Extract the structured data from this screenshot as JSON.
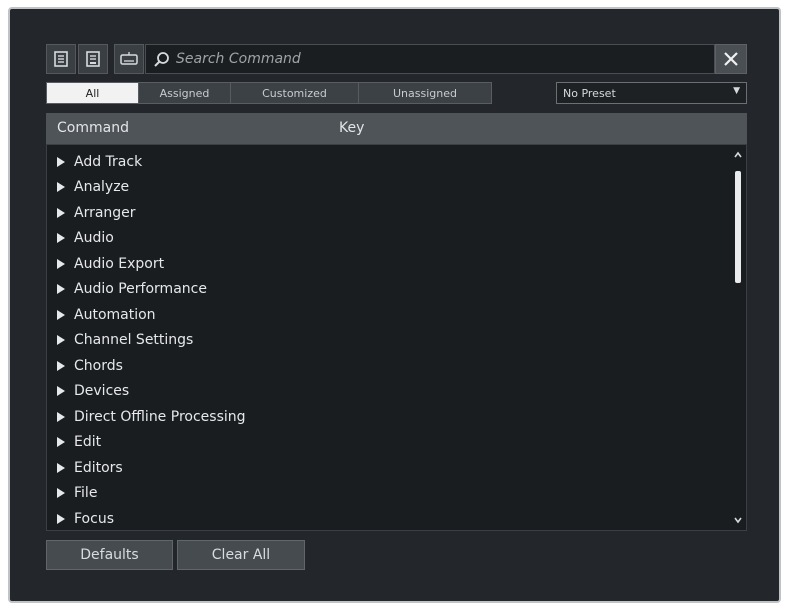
{
  "toolbar": {
    "buttons": [
      {
        "icon": "import-keycommands-icon"
      },
      {
        "icon": "export-keycommands-icon"
      },
      {
        "icon": "keyboard-icon"
      }
    ],
    "search_placeholder": "Search Command",
    "close_icon": "close-icon"
  },
  "filters": {
    "tabs": [
      {
        "label": "All",
        "active": true
      },
      {
        "label": "Assigned",
        "active": false
      },
      {
        "label": "Customized",
        "active": false
      },
      {
        "label": "Unassigned",
        "active": false
      }
    ]
  },
  "preset": {
    "value": "No Preset"
  },
  "table": {
    "columns": [
      "Command",
      "Key"
    ],
    "rows": [
      "Add Track",
      "Analyze",
      "Arranger",
      "Audio",
      "Audio Export",
      "Audio Performance",
      "Automation",
      "Channel Settings",
      "Chords",
      "Devices",
      "Direct Offline Processing",
      "Edit",
      "Editors",
      "File",
      "Focus"
    ]
  },
  "footer": {
    "defaults_label": "Defaults",
    "clear_all_label": "Clear All"
  },
  "colors": {
    "background": "#23272b",
    "header": "#4f5459",
    "list": "#1a1d20",
    "active_tab": "#f2f2f2"
  }
}
